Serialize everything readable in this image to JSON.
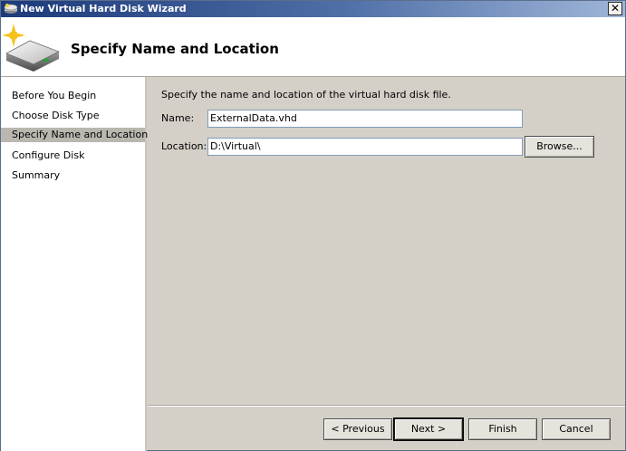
{
  "window": {
    "title": "New Virtual Hard Disk Wizard",
    "close_glyph": "✕"
  },
  "header": {
    "title": "Specify Name and Location",
    "icon": "hard-disk-icon"
  },
  "steps": [
    {
      "label": "Before You Begin",
      "active": false
    },
    {
      "label": "Choose Disk Type",
      "active": false
    },
    {
      "label": "Specify Name and Location",
      "active": true
    },
    {
      "label": "Configure Disk",
      "active": false
    },
    {
      "label": "Summary",
      "active": false
    }
  ],
  "form": {
    "intro": "Specify the name and location of the virtual hard disk file.",
    "name_label": "Name:",
    "name_value": "ExternalData.vhd",
    "location_label": "Location:",
    "location_value": "D:\\Virtual\\",
    "browse_label": "Browse..."
  },
  "footer": {
    "previous_label": "< Previous",
    "next_label": "Next >",
    "finish_label": "Finish",
    "cancel_label": "Cancel"
  }
}
